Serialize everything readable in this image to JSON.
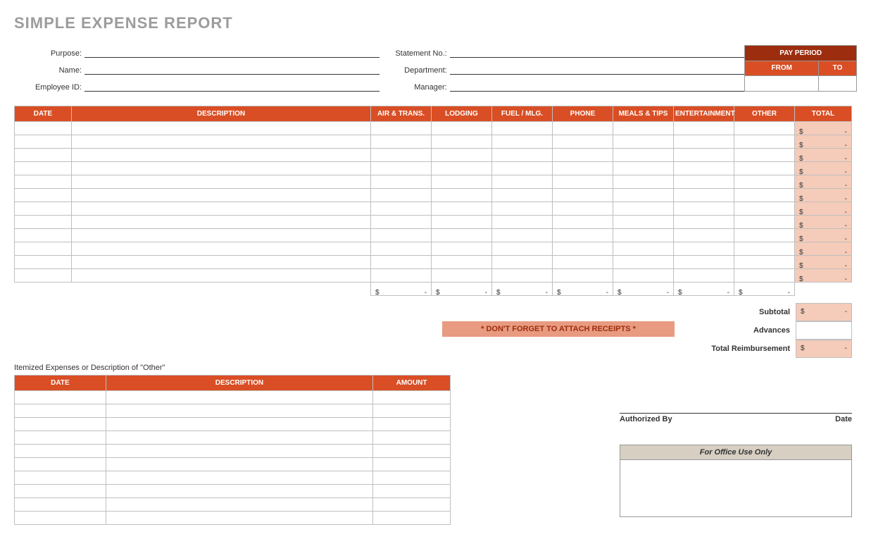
{
  "title": "SIMPLE EXPENSE REPORT",
  "fields": {
    "purpose_label": "Purpose:",
    "name_label": "Name:",
    "employee_id_label": "Employee ID:",
    "statement_no_label": "Statement No.:",
    "department_label": "Department:",
    "manager_label": "Manager:",
    "purpose": "",
    "name": "",
    "employee_id": "",
    "statement_no": "",
    "department": "",
    "manager": ""
  },
  "pay_period": {
    "title": "PAY PERIOD",
    "from_label": "FROM",
    "to_label": "TO",
    "from": "",
    "to": ""
  },
  "main_table": {
    "headers": {
      "date": "DATE",
      "description": "DESCRIPTION",
      "air_trans": "AIR & TRANS.",
      "lodging": "LODGING",
      "fuel_mlg": "FUEL / MLG.",
      "phone": "PHONE",
      "meals_tips": "MEALS & TIPS",
      "entertainment": "ENTERTAINMENT",
      "other": "OTHER",
      "total": "TOTAL"
    },
    "row_count": 12,
    "row_total": {
      "currency": "$",
      "value": "-"
    },
    "column_sum": {
      "currency": "$",
      "value": "-"
    }
  },
  "summary": {
    "subtotal_label": "Subtotal",
    "advances_label": "Advances",
    "reimbursement_label": "Total Reimbursement",
    "currency": "$",
    "dash": "-"
  },
  "receipts_note": "* DON'T FORGET TO ATTACH RECEIPTS *",
  "itemized": {
    "caption": "Itemized Expenses or Description of \"Other\"",
    "headers": {
      "date": "DATE",
      "description": "DESCRIPTION",
      "amount": "AMOUNT"
    },
    "row_count": 10
  },
  "signature": {
    "authorized_by": "Authorized By",
    "date": "Date"
  },
  "office": {
    "title": "For Office Use Only"
  }
}
